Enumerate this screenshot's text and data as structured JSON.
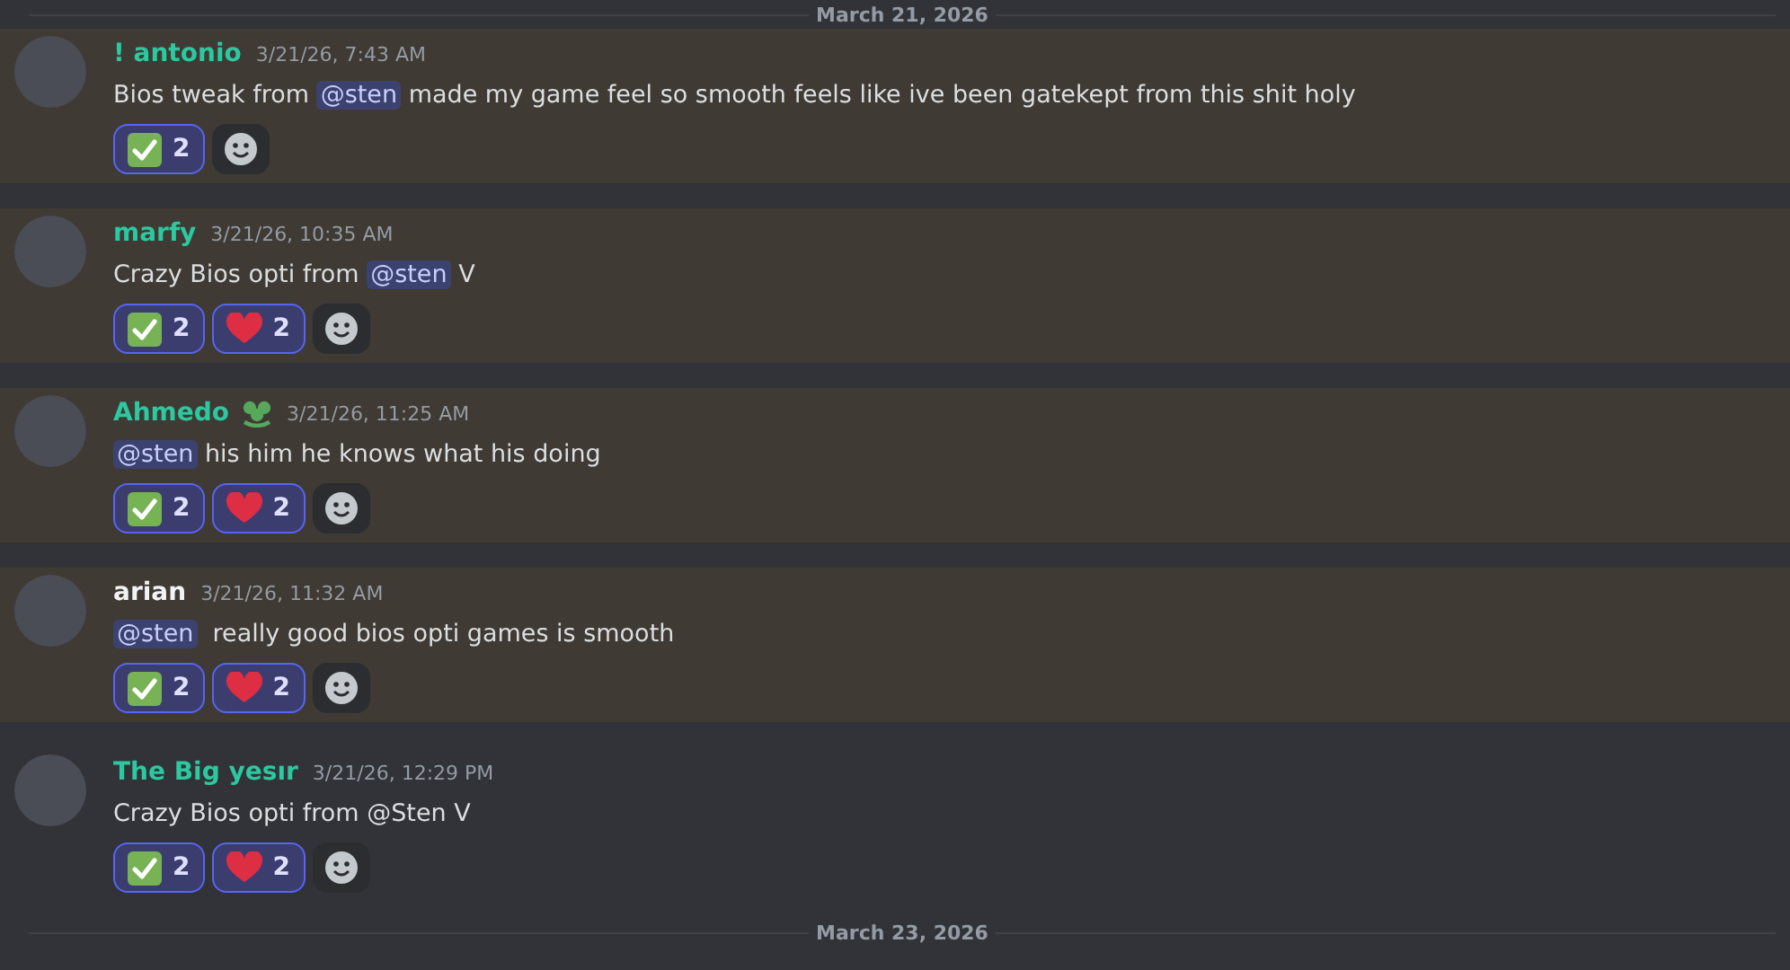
{
  "dividers": [
    {
      "label": "March 21, 2026"
    },
    {
      "label": "March 23, 2026"
    }
  ],
  "messages": [
    {
      "author": "! antonio",
      "color": "#2dc7a0",
      "role_icon": false,
      "timestamp": "3/21/26, 7:43 AM",
      "highlighted": true,
      "content": [
        {
          "kind": "text",
          "text": "Bios tweak from "
        },
        {
          "kind": "mention",
          "text": "@sten"
        },
        {
          "kind": "text",
          "text": " made my game feel so smooth feels like ive been gatekept from this shit holy"
        }
      ],
      "reactions": [
        {
          "kind": "check",
          "count": "2",
          "selected": true
        }
      ]
    },
    {
      "author": "marfy",
      "color": "#2dc7a0",
      "role_icon": false,
      "timestamp": "3/21/26, 10:35 AM",
      "highlighted": true,
      "content": [
        {
          "kind": "text",
          "text": "Crazy Bios opti from "
        },
        {
          "kind": "mention",
          "text": "@sten"
        },
        {
          "kind": "text",
          "text": " V"
        }
      ],
      "reactions": [
        {
          "kind": "check",
          "count": "2",
          "selected": true
        },
        {
          "kind": "heart",
          "count": "2",
          "selected": true
        }
      ]
    },
    {
      "author": "Ahmedo",
      "color": "#2dc7a0",
      "role_icon": true,
      "timestamp": "3/21/26, 11:25 AM",
      "highlighted": true,
      "content": [
        {
          "kind": "mention",
          "text": "@sten"
        },
        {
          "kind": "text",
          "text": " his him he knows what his doing"
        }
      ],
      "reactions": [
        {
          "kind": "check",
          "count": "2",
          "selected": true
        },
        {
          "kind": "heart",
          "count": "2",
          "selected": true
        }
      ]
    },
    {
      "author": "arian",
      "color": "#f2f3f5",
      "role_icon": false,
      "timestamp": "3/21/26, 11:32 AM",
      "highlighted": true,
      "content": [
        {
          "kind": "mention",
          "text": "@sten"
        },
        {
          "kind": "text",
          "text": "  really good bios opti games is smooth"
        }
      ],
      "reactions": [
        {
          "kind": "check",
          "count": "2",
          "selected": true
        },
        {
          "kind": "heart",
          "count": "2",
          "selected": true
        }
      ]
    },
    {
      "author": "The Big yesır",
      "color": "#2dc7a0",
      "role_icon": false,
      "timestamp": "3/21/26, 12:29 PM",
      "highlighted": false,
      "content": [
        {
          "kind": "text",
          "text": "Crazy Bios opti from @Sten V"
        }
      ],
      "reactions": [
        {
          "kind": "check",
          "count": "2",
          "selected": true
        },
        {
          "kind": "heart",
          "count": "2",
          "selected": true
        }
      ]
    }
  ]
}
